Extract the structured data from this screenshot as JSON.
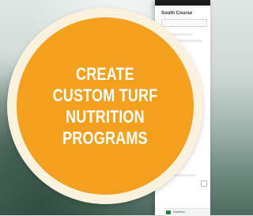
{
  "app_panel": {
    "label": "South Course",
    "bottom_bar_text": "Nutrition"
  },
  "badge": {
    "lines": [
      "CREATE",
      "CUSTOM TURF",
      "NUTRITION",
      "PROGRAMS"
    ],
    "ring_color": "#fbf2de",
    "disc_color": "#f2a01e",
    "text_color": "#ffffff"
  }
}
